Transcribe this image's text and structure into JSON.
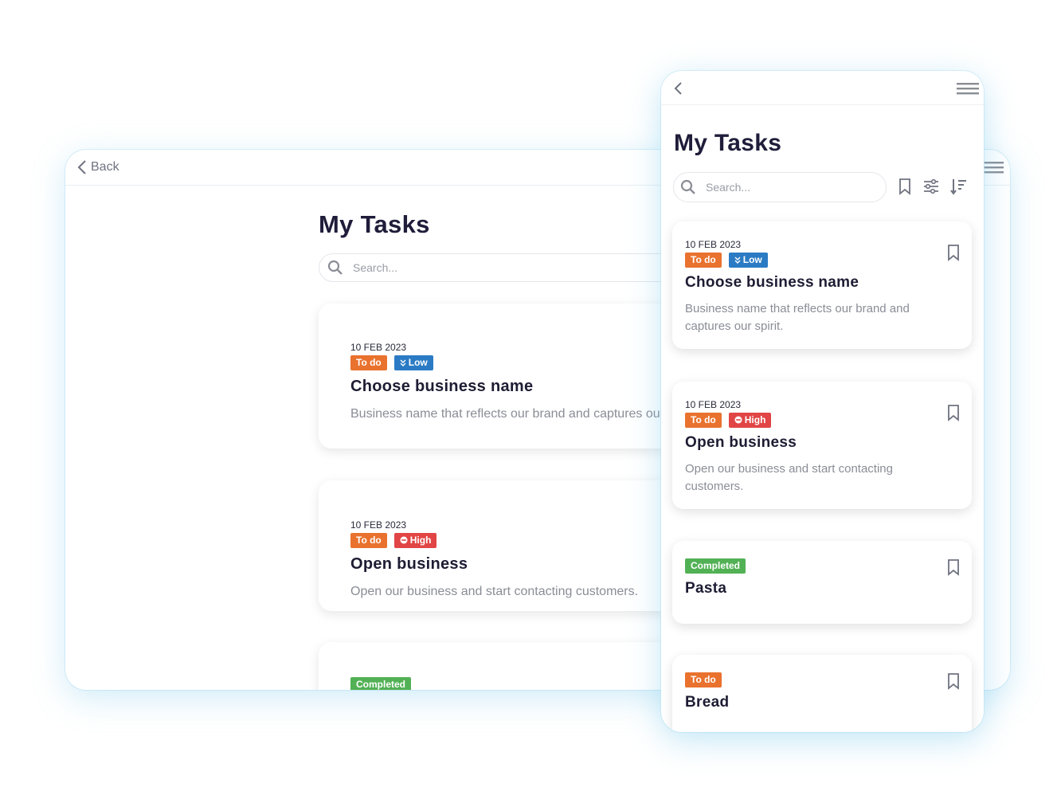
{
  "desktop": {
    "back_label": "Back",
    "title": "My Tasks",
    "search_placeholder": "Search...",
    "tasks": [
      {
        "date": "10 FEB 2023",
        "status": "To do",
        "priority": "Low",
        "title": "Choose business name",
        "description": "Business name that reflects our brand and captures our"
      },
      {
        "date": "10 FEB 2023",
        "status": "To do",
        "priority": "High",
        "title": "Open business",
        "description": "Open our business and start contacting customers."
      },
      {
        "status": "Completed"
      }
    ]
  },
  "phone": {
    "title": "My Tasks",
    "search_placeholder": "Search...",
    "tasks": [
      {
        "date": "10 FEB 2023",
        "status": "To do",
        "priority": "Low",
        "title": "Choose business name",
        "description": "Business name that reflects our brand and captures our spirit."
      },
      {
        "date": "10 FEB 2023",
        "status": "To do",
        "priority": "High",
        "title": "Open business",
        "description": "Open our business and start contacting customers."
      },
      {
        "status": "Completed",
        "title": "Pasta"
      },
      {
        "status": "To do",
        "title": "Bread"
      }
    ]
  },
  "colors": {
    "todo": "#e9722e",
    "low": "#2b7bc4",
    "high": "#e14545",
    "completed": "#52b155",
    "title_text": "#1f1d3a",
    "muted_text": "#8a8d96"
  },
  "icons": [
    "chevron-left-icon",
    "hamburger-menu-icon",
    "search-icon",
    "bookmark-icon",
    "filter-sliders-icon",
    "sort-icon",
    "chevrons-down-icon",
    "minus-circle-icon"
  ]
}
